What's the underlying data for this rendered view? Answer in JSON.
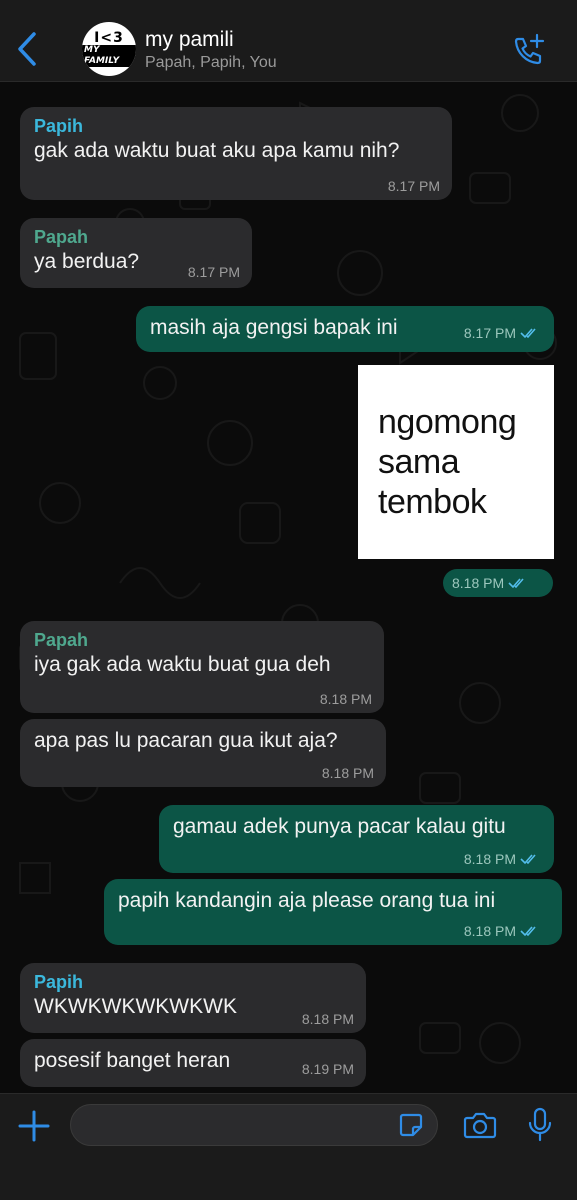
{
  "header": {
    "title": "my pamili",
    "participants": "Papah, Papih, You",
    "avatar_text_top": "I<3",
    "avatar_text_bottom": "MY FAMILY",
    "icons": {
      "back": "chevron-left-icon",
      "call": "add-call-icon"
    }
  },
  "messages": [
    {
      "direction": "in",
      "sender": "Papih",
      "text": "gak ada waktu buat aku apa kamu nih?",
      "time": "8.17 PM"
    },
    {
      "direction": "in",
      "sender": "Papah",
      "text": "ya berdua?",
      "time": "8.17 PM"
    },
    {
      "direction": "out",
      "text": "masih aja gengsi bapak ini",
      "time": "8.17 PM",
      "read": true
    },
    {
      "direction": "out",
      "type": "sticker",
      "sticker_lines": [
        "ngomong",
        "sama",
        "tembok"
      ],
      "time": "8.18 PM",
      "read": true
    },
    {
      "direction": "in",
      "sender": "Papah",
      "text": "iya gak ada waktu buat gua deh",
      "time": "8.18 PM"
    },
    {
      "direction": "in",
      "text": "apa pas lu pacaran gua ikut aja?",
      "time": "8.18 PM"
    },
    {
      "direction": "out",
      "text": "gamau adek punya pacar kalau gitu",
      "time": "8.18 PM",
      "read": true
    },
    {
      "direction": "out",
      "text": "papih kandangin aja please orang tua ini",
      "time": "8.18 PM",
      "read": true
    },
    {
      "direction": "in",
      "sender": "Papih",
      "text": "WKWKWKWKWKWK",
      "time": "8.18 PM"
    },
    {
      "direction": "in",
      "text": "posesif banget heran",
      "time": "8.19 PM"
    }
  ],
  "input_bar": {
    "placeholder": "",
    "icons": {
      "attach": "plus-icon",
      "sticker": "sticker-icon",
      "camera": "camera-icon",
      "voice": "microphone-icon"
    }
  },
  "colors": {
    "accent": "#2f8ce6",
    "incoming_bubble": "#2b2b2d",
    "outgoing_bubble": "#0c5546",
    "papih_name": "#3bb8dc",
    "papah_name": "#4fa88e",
    "read_ticks": "#53bdeb"
  }
}
